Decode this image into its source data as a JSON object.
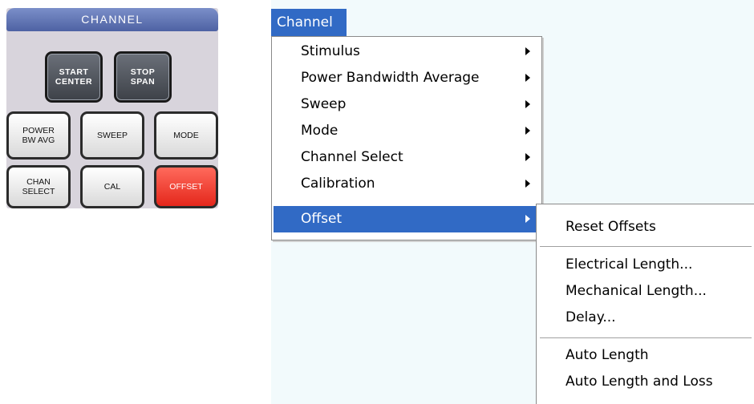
{
  "panel": {
    "title": "CHANNEL",
    "keys": {
      "start_center": [
        "START",
        "CENTER"
      ],
      "stop_span": [
        "STOP",
        "SPAN"
      ],
      "power_bw_avg": [
        "POWER",
        "BW AVG"
      ],
      "sweep": "SWEEP",
      "mode": "MODE",
      "chan_select": [
        "CHAN",
        "SELECT"
      ],
      "cal": "CAL",
      "offset": "OFFSET"
    }
  },
  "menubar": {
    "channel_label": "Channel"
  },
  "menu": {
    "items": [
      {
        "label": "Stimulus",
        "has_submenu": true
      },
      {
        "label": "Power Bandwidth Average",
        "has_submenu": true
      },
      {
        "label": "Sweep",
        "has_submenu": true
      },
      {
        "label": "Mode",
        "has_submenu": true
      },
      {
        "label": "Channel Select",
        "has_submenu": true
      },
      {
        "label": "Calibration",
        "has_submenu": true
      },
      {
        "label": "Offset",
        "has_submenu": true,
        "selected": true
      }
    ]
  },
  "submenu": {
    "groups": [
      [
        "Reset Offsets"
      ],
      [
        "Electrical Length...",
        "Mechanical Length...",
        "Delay..."
      ],
      [
        "Auto Length",
        "Auto Length and Loss"
      ]
    ]
  },
  "colors": {
    "selection": "#316ac5",
    "offset_key": "#e4271b",
    "panel_title": "#4e62a3"
  }
}
